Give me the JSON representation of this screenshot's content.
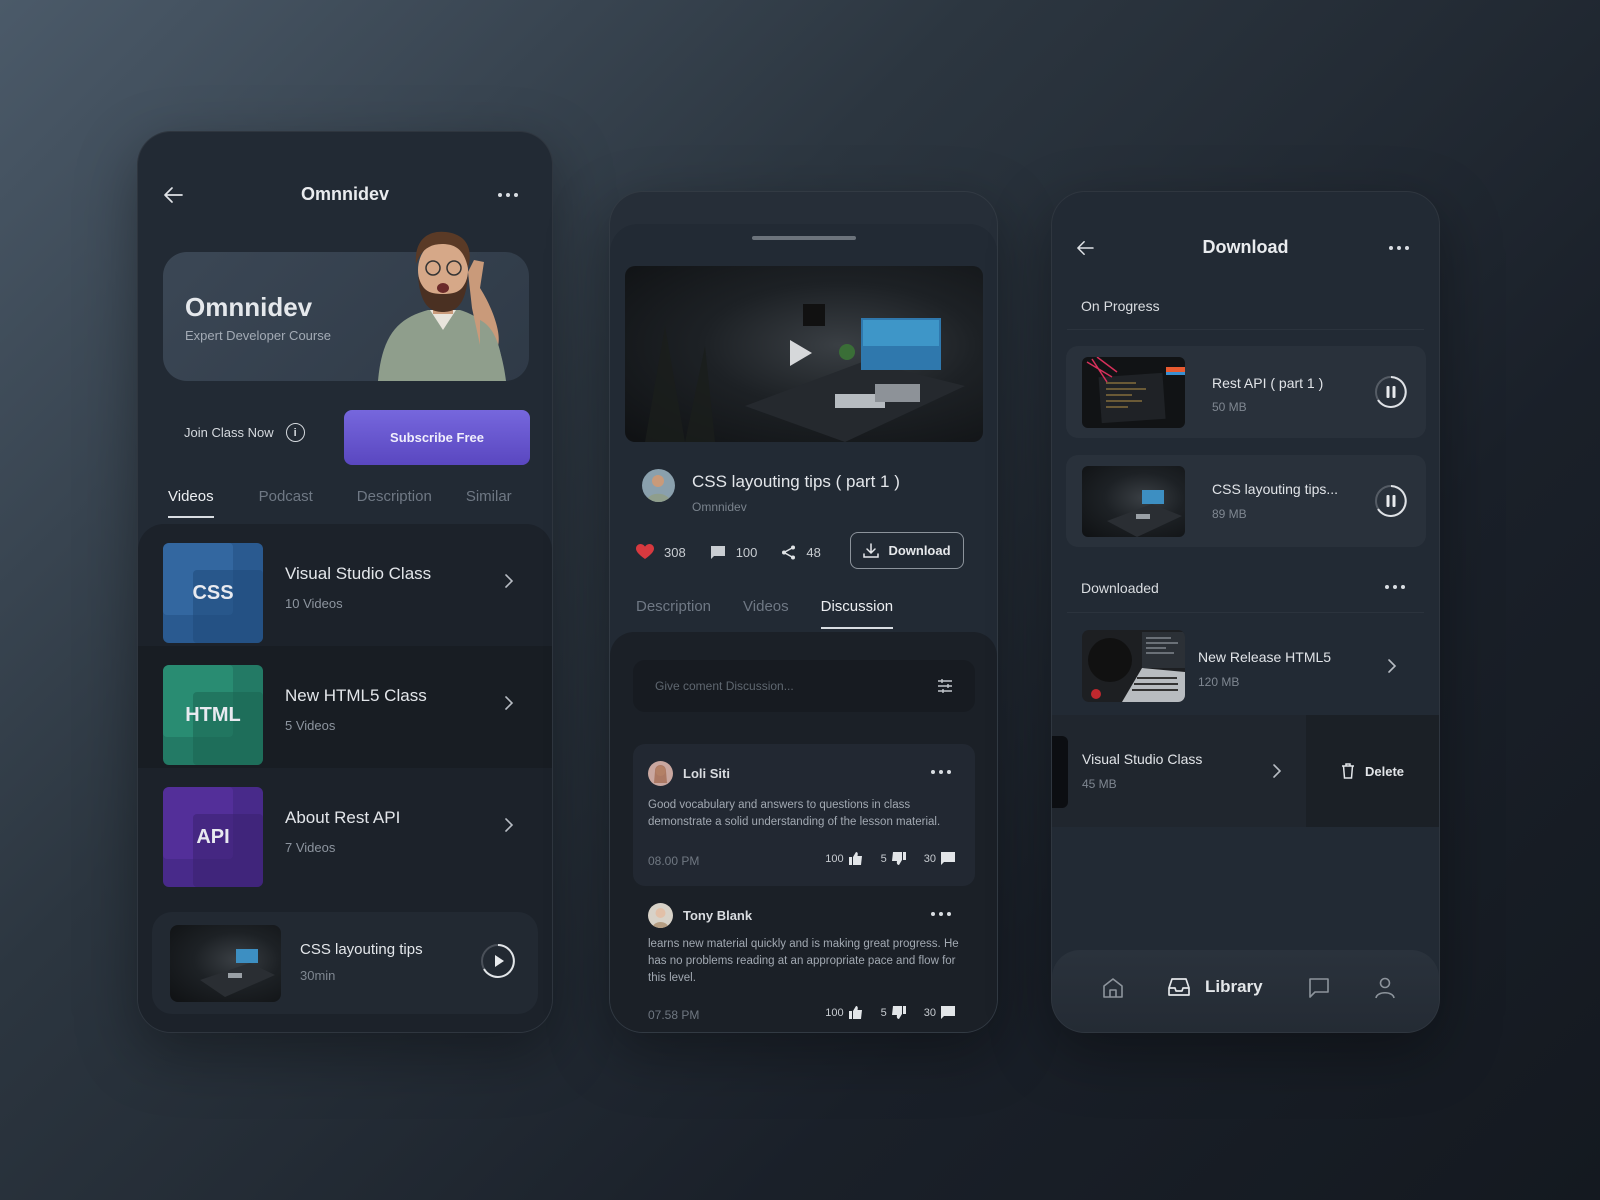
{
  "colors": {
    "accent": "#6b5bd6",
    "heart": "#e0434a",
    "css_tile": "#2b5d94",
    "html_tile": "#24806a",
    "api_tile": "#4a2a8c"
  },
  "screen1": {
    "header_title": "Omnnidev",
    "back_icon": "arrow-left-icon",
    "more_icon": "more-horizontal-icon",
    "hero": {
      "name": "Omnnidev",
      "subtitle": "Expert Developer Course"
    },
    "join_label": "Join Class Now",
    "subscribe_label": "Subscribe Free",
    "tabs": [
      "Videos",
      "Podcast",
      "Description",
      "Similar"
    ],
    "active_tab": "Videos",
    "courses": [
      {
        "tile": "CSS",
        "title": "Visual Studio Class",
        "subtitle": "10 Videos"
      },
      {
        "tile": "HTML",
        "title": "New  HTML5 Class",
        "subtitle": "5 Videos"
      },
      {
        "tile": "API",
        "title": "About Rest API",
        "subtitle": "7 Videos"
      }
    ],
    "now_playing": {
      "title": "CSS layouting tips",
      "subtitle": "30min"
    }
  },
  "screen2": {
    "video_title": "CSS layouting tips ( part 1 )",
    "author": "Omnnidev",
    "likes": "308",
    "comments": "100",
    "shares": "48",
    "download_label": "Download",
    "tabs": [
      "Description",
      "Videos",
      "Discussion"
    ],
    "active_tab": "Discussion",
    "comment_placeholder": "Give coment Discussion...",
    "discussion": [
      {
        "name": "Loli Siti",
        "text": "Good vocabulary and answers to questions in class demonstrate a solid understanding of the lesson material.",
        "time": "08.00 PM",
        "likes": "100",
        "dislikes": "5",
        "replies": "30"
      },
      {
        "name": "Tony Blank",
        "text": "learns new material quickly and is making great progress. He has no problems reading at an appropriate pace and flow for this level.",
        "time": "07.58 PM",
        "likes": "100",
        "dislikes": "5",
        "replies": "30"
      }
    ]
  },
  "screen3": {
    "header_title": "Download",
    "on_progress_label": "On Progress",
    "in_progress": [
      {
        "title": "Rest API ( part 1  )",
        "size": "50 MB"
      },
      {
        "title": "CSS layouting tips...",
        "size": "89 MB"
      }
    ],
    "downloaded_label": "Downloaded",
    "downloaded": [
      {
        "title": "New Release HTML5",
        "size": "120 MB"
      },
      {
        "title": "Visual Studio Class",
        "size": "45 MB"
      }
    ],
    "delete_label": "Delete",
    "nav": {
      "active_label": "Library",
      "items": [
        "home-icon",
        "library-icon",
        "chat-icon",
        "profile-icon"
      ]
    }
  }
}
